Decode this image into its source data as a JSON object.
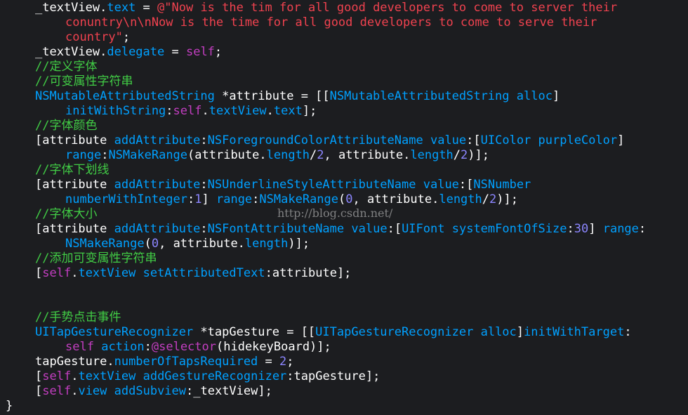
{
  "code": {
    "lines": [
      {
        "indent": 1,
        "tokens": [
          {
            "t": "_textView.",
            "c": ""
          },
          {
            "t": "text",
            "c": "prop"
          },
          {
            "t": " = ",
            "c": ""
          },
          {
            "t": "@\"Now is the tim for all good developers to come to server their",
            "c": "str"
          }
        ]
      },
      {
        "indent": 2,
        "tokens": [
          {
            "t": "conuntry\\n\\nNow is the time for all good developers to come to serve their",
            "c": "str"
          }
        ]
      },
      {
        "indent": 2,
        "tokens": [
          {
            "t": "country\"",
            "c": "str"
          },
          {
            "t": ";",
            "c": ""
          }
        ]
      },
      {
        "indent": 1,
        "tokens": [
          {
            "t": "_textView.",
            "c": ""
          },
          {
            "t": "delegate",
            "c": "prop"
          },
          {
            "t": " = ",
            "c": ""
          },
          {
            "t": "self",
            "c": "kw"
          },
          {
            "t": ";",
            "c": ""
          }
        ]
      },
      {
        "indent": 1,
        "tokens": [
          {
            "t": "//定义字体",
            "c": "cm"
          }
        ]
      },
      {
        "indent": 1,
        "tokens": [
          {
            "t": "//可变属性字符串",
            "c": "cm"
          }
        ]
      },
      {
        "indent": 1,
        "tokens": [
          {
            "t": "NSMutableAttributedString",
            "c": "ty"
          },
          {
            "t": " *attribute = [[",
            "c": ""
          },
          {
            "t": "NSMutableAttributedString",
            "c": "ty"
          },
          {
            "t": " ",
            "c": ""
          },
          {
            "t": "alloc",
            "c": "ty"
          },
          {
            "t": "]",
            "c": ""
          }
        ]
      },
      {
        "indent": 2,
        "tokens": [
          {
            "t": "initWithString",
            "c": "ty"
          },
          {
            "t": ":",
            "c": ""
          },
          {
            "t": "self",
            "c": "kw"
          },
          {
            "t": ".",
            "c": ""
          },
          {
            "t": "textView",
            "c": "prop"
          },
          {
            "t": ".",
            "c": ""
          },
          {
            "t": "text",
            "c": "prop"
          },
          {
            "t": "];",
            "c": ""
          }
        ]
      },
      {
        "indent": 1,
        "tokens": [
          {
            "t": "//字体颜色",
            "c": "cm"
          }
        ]
      },
      {
        "indent": 1,
        "tokens": [
          {
            "t": "[attribute ",
            "c": ""
          },
          {
            "t": "addAttribute",
            "c": "ty"
          },
          {
            "t": ":",
            "c": ""
          },
          {
            "t": "NSForegroundColorAttributeName",
            "c": "ty"
          },
          {
            "t": " ",
            "c": ""
          },
          {
            "t": "value",
            "c": "ty"
          },
          {
            "t": ":[",
            "c": ""
          },
          {
            "t": "UIColor",
            "c": "ty"
          },
          {
            "t": " ",
            "c": ""
          },
          {
            "t": "purpleColor",
            "c": "ty"
          },
          {
            "t": "]",
            "c": ""
          }
        ]
      },
      {
        "indent": 2,
        "tokens": [
          {
            "t": "range",
            "c": "ty"
          },
          {
            "t": ":",
            "c": ""
          },
          {
            "t": "NSMakeRange",
            "c": "ty"
          },
          {
            "t": "(attribute.",
            "c": ""
          },
          {
            "t": "length",
            "c": "prop"
          },
          {
            "t": "/",
            "c": ""
          },
          {
            "t": "2",
            "c": "num"
          },
          {
            "t": ", attribute.",
            "c": ""
          },
          {
            "t": "length",
            "c": "prop"
          },
          {
            "t": "/",
            "c": ""
          },
          {
            "t": "2",
            "c": "num"
          },
          {
            "t": ")];",
            "c": ""
          }
        ]
      },
      {
        "indent": 1,
        "tokens": [
          {
            "t": "//字体下划线",
            "c": "cm"
          }
        ]
      },
      {
        "indent": 1,
        "tokens": [
          {
            "t": "[attribute ",
            "c": ""
          },
          {
            "t": "addAttribute",
            "c": "ty"
          },
          {
            "t": ":",
            "c": ""
          },
          {
            "t": "NSUnderlineStyleAttributeName",
            "c": "ty"
          },
          {
            "t": " ",
            "c": ""
          },
          {
            "t": "value",
            "c": "ty"
          },
          {
            "t": ":[",
            "c": ""
          },
          {
            "t": "NSNumber",
            "c": "ty"
          }
        ]
      },
      {
        "indent": 2,
        "tokens": [
          {
            "t": "numberWithInteger",
            "c": "ty"
          },
          {
            "t": ":",
            "c": ""
          },
          {
            "t": "1",
            "c": "num"
          },
          {
            "t": "] ",
            "c": ""
          },
          {
            "t": "range",
            "c": "ty"
          },
          {
            "t": ":",
            "c": ""
          },
          {
            "t": "NSMakeRange",
            "c": "ty"
          },
          {
            "t": "(",
            "c": ""
          },
          {
            "t": "0",
            "c": "num"
          },
          {
            "t": ", attribute.",
            "c": ""
          },
          {
            "t": "length",
            "c": "prop"
          },
          {
            "t": "/",
            "c": ""
          },
          {
            "t": "2",
            "c": "num"
          },
          {
            "t": ")];",
            "c": ""
          }
        ]
      },
      {
        "indent": 1,
        "tokens": [
          {
            "t": "//字体大小",
            "c": "cm"
          }
        ]
      },
      {
        "indent": 1,
        "tokens": [
          {
            "t": "[attribute ",
            "c": ""
          },
          {
            "t": "addAttribute",
            "c": "ty"
          },
          {
            "t": ":",
            "c": ""
          },
          {
            "t": "NSFontAttributeName",
            "c": "ty"
          },
          {
            "t": " ",
            "c": ""
          },
          {
            "t": "value",
            "c": "ty"
          },
          {
            "t": ":[",
            "c": ""
          },
          {
            "t": "UIFont",
            "c": "ty"
          },
          {
            "t": " ",
            "c": ""
          },
          {
            "t": "systemFontOfSize",
            "c": "ty"
          },
          {
            "t": ":",
            "c": ""
          },
          {
            "t": "30",
            "c": "num"
          },
          {
            "t": "] ",
            "c": ""
          },
          {
            "t": "range",
            "c": "ty"
          },
          {
            "t": ":",
            "c": ""
          }
        ]
      },
      {
        "indent": 2,
        "tokens": [
          {
            "t": "NSMakeRange",
            "c": "ty"
          },
          {
            "t": "(",
            "c": ""
          },
          {
            "t": "0",
            "c": "num"
          },
          {
            "t": ", attribute.",
            "c": ""
          },
          {
            "t": "length",
            "c": "prop"
          },
          {
            "t": ")];",
            "c": ""
          }
        ]
      },
      {
        "indent": 1,
        "tokens": [
          {
            "t": "//添加可变属性字符串",
            "c": "cm"
          }
        ]
      },
      {
        "indent": 1,
        "tokens": [
          {
            "t": "[",
            "c": ""
          },
          {
            "t": "self",
            "c": "kw"
          },
          {
            "t": ".",
            "c": ""
          },
          {
            "t": "textView",
            "c": "prop"
          },
          {
            "t": " ",
            "c": ""
          },
          {
            "t": "setAttributedText",
            "c": "ty"
          },
          {
            "t": ":attribute];",
            "c": ""
          }
        ]
      },
      {
        "indent": 0,
        "tokens": []
      },
      {
        "indent": 0,
        "tokens": []
      },
      {
        "indent": 1,
        "tokens": [
          {
            "t": "//手势点击事件",
            "c": "cm"
          }
        ]
      },
      {
        "indent": 1,
        "tokens": [
          {
            "t": "UITapGestureRecognizer",
            "c": "ty"
          },
          {
            "t": " *tapGesture = [[",
            "c": ""
          },
          {
            "t": "UITapGestureRecognizer",
            "c": "ty"
          },
          {
            "t": " ",
            "c": ""
          },
          {
            "t": "alloc",
            "c": "ty"
          },
          {
            "t": "]",
            "c": ""
          },
          {
            "t": "initWithTarget",
            "c": "ty"
          },
          {
            "t": ":",
            "c": ""
          }
        ]
      },
      {
        "indent": 2,
        "tokens": [
          {
            "t": "self",
            "c": "kw"
          },
          {
            "t": " ",
            "c": ""
          },
          {
            "t": "action",
            "c": "ty"
          },
          {
            "t": ":",
            "c": ""
          },
          {
            "t": "@selector",
            "c": "kw"
          },
          {
            "t": "(hidekeyBoard)];",
            "c": ""
          }
        ]
      },
      {
        "indent": 1,
        "tokens": [
          {
            "t": "tapGesture.",
            "c": ""
          },
          {
            "t": "numberOfTapsRequired",
            "c": "prop"
          },
          {
            "t": " = ",
            "c": ""
          },
          {
            "t": "2",
            "c": "num"
          },
          {
            "t": ";",
            "c": ""
          }
        ]
      },
      {
        "indent": 1,
        "tokens": [
          {
            "t": "[",
            "c": ""
          },
          {
            "t": "self",
            "c": "kw"
          },
          {
            "t": ".",
            "c": ""
          },
          {
            "t": "textView",
            "c": "prop"
          },
          {
            "t": " ",
            "c": ""
          },
          {
            "t": "addGestureRecognizer",
            "c": "ty"
          },
          {
            "t": ":tapGesture];",
            "c": ""
          }
        ]
      },
      {
        "indent": 1,
        "tokens": [
          {
            "t": "[",
            "c": ""
          },
          {
            "t": "self",
            "c": "kw"
          },
          {
            "t": ".",
            "c": ""
          },
          {
            "t": "view",
            "c": "prop"
          },
          {
            "t": " ",
            "c": ""
          },
          {
            "t": "addSubview",
            "c": "ty"
          },
          {
            "t": ":_textView];",
            "c": ""
          }
        ]
      },
      {
        "indent": 0,
        "tokens": [
          {
            "t": "}",
            "c": ""
          }
        ]
      }
    ]
  },
  "watermark": "http://blog.csdn.net/",
  "colors": {
    "background": "#1c1d20",
    "keyword": "#c33ec1",
    "string": "#f0424f",
    "comment": "#41cc45",
    "type": "#00a0ff",
    "number": "#8c86ff",
    "plain": "#ffffff"
  }
}
